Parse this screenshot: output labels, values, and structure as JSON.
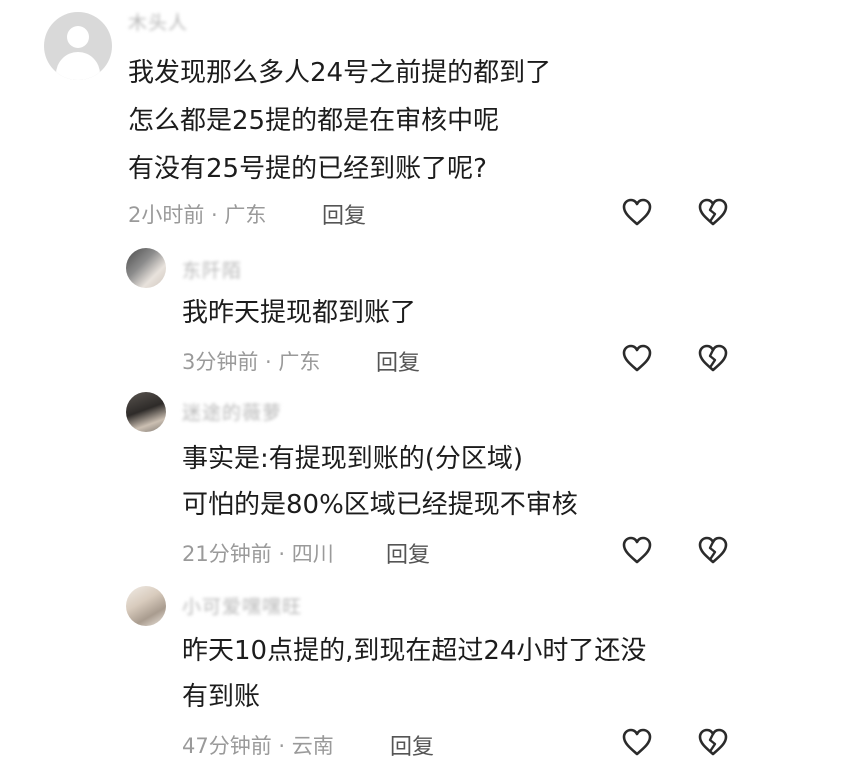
{
  "comments": [
    {
      "username": "木头人",
      "lines": [
        "我发现那么多人24号之前提的都到了",
        "怎么都是25提的都是在审核中呢",
        "有没有25号提的已经到账了呢?"
      ],
      "meta": "2小时前 · 广东",
      "reply_label": "回复",
      "avatar_icon": "default-avatar-icon"
    }
  ],
  "replies": [
    {
      "username": "东阡陌",
      "lines": [
        "我昨天提现都到账了"
      ],
      "meta": "3分钟前 · 广东",
      "reply_label": "回复",
      "avatar_icon": "user-avatar"
    },
    {
      "username": "迷途的薇萝",
      "lines": [
        "事实是:有提现到账的(分区域)",
        "可怕的是80%区域已经提现不审核"
      ],
      "meta": "21分钟前 · 四川",
      "reply_label": "回复",
      "avatar_icon": "user-avatar"
    },
    {
      "username": "小可爱嘿嘿旺",
      "lines": [
        "昨天10点提的,到现在超过24小时了还没",
        "有到账"
      ],
      "meta": "47分钟前 · 云南",
      "reply_label": "回复",
      "avatar_icon": "user-avatar"
    }
  ],
  "icons": {
    "like": "heart-outline-icon",
    "dislike": "broken-heart-icon"
  }
}
